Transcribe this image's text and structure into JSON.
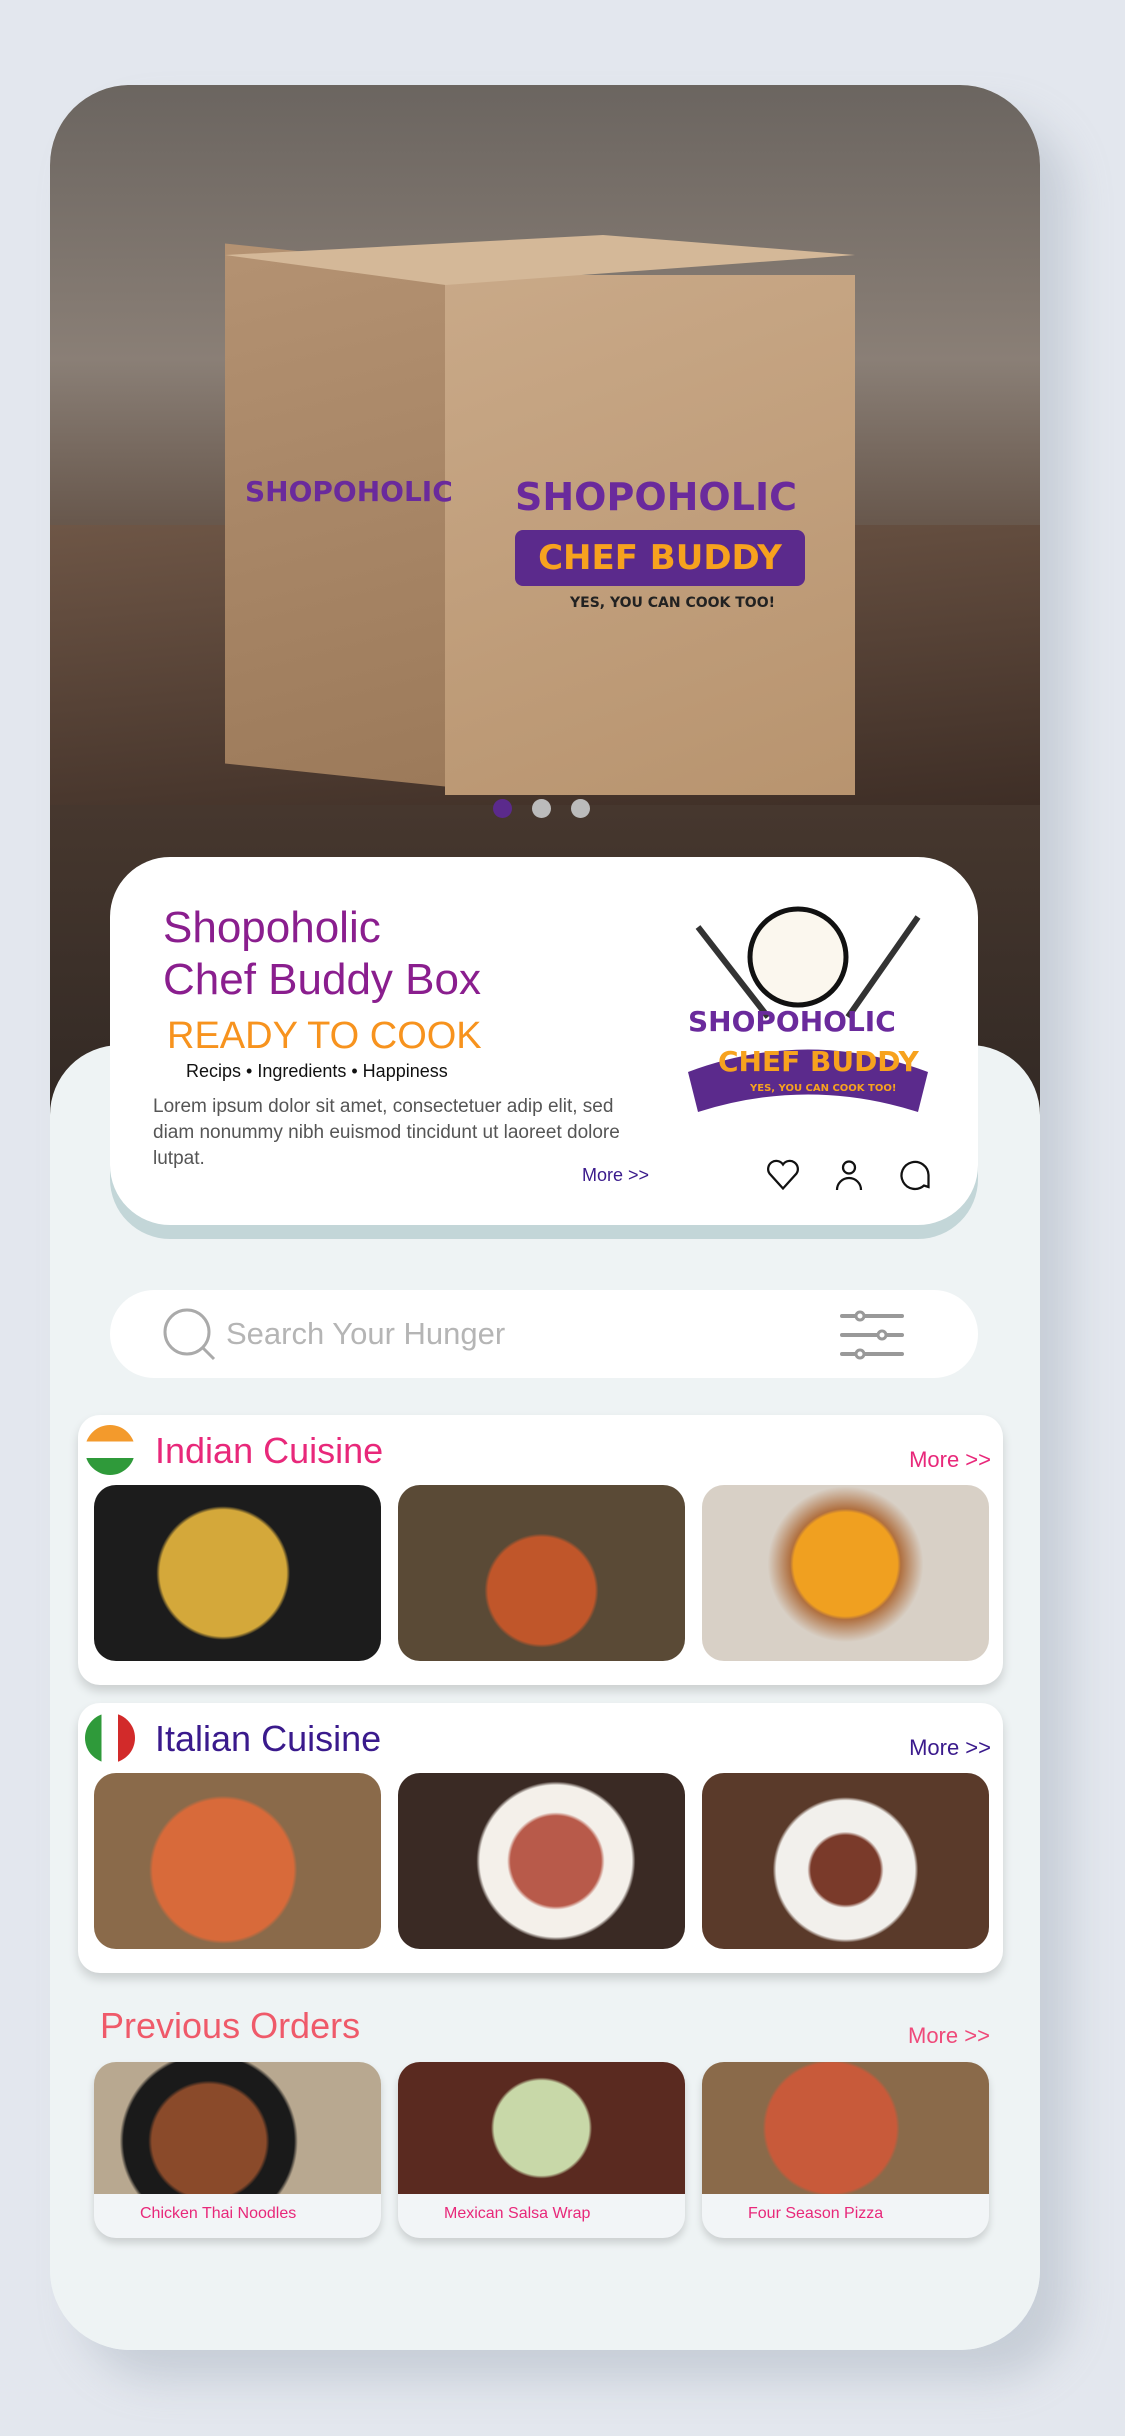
{
  "hero": {
    "logo_brand": "SHOPOHOLIC",
    "logo_title": "CHEF BUDDY",
    "logo_tagline": "YES, YOU CAN COOK TOO!",
    "carousel_total": 3,
    "carousel_active": 1
  },
  "info": {
    "title_line1": "Shopoholic",
    "title_line2": "Chef Buddy Box",
    "subtitle": "READY TO COOK",
    "tags": "Recips • Ingredients • Happiness",
    "description": "Lorem ipsum dolor sit amet, consectetuer adip elit, sed diam nonummy nibh euismod tincidunt ut laoreet dolore lutpat.",
    "more": "More >>"
  },
  "search": {
    "placeholder": "Search Your Hunger"
  },
  "sections": [
    {
      "title": "Indian Cuisine",
      "more": "More >>",
      "color": "#e8287a"
    },
    {
      "title": "Italian Cuisine",
      "more": "More >>",
      "color": "#3a1a8c"
    }
  ],
  "previous": {
    "title": "Previous Orders",
    "more": "More >>",
    "items": [
      "Chicken Thai Noodles",
      "Mexican Salsa Wrap",
      "Four Season Pizza"
    ]
  }
}
